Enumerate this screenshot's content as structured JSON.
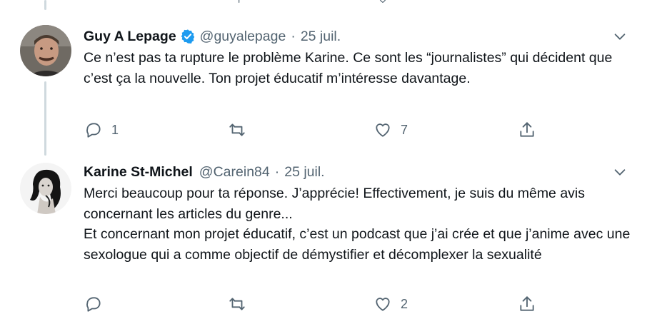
{
  "colors": {
    "accent": "#1d9bf0",
    "muted": "#536471",
    "text": "#0f1419",
    "thread_line": "#cfd9de"
  },
  "tweets": [
    {
      "name": "Guy A Lepage",
      "verified": true,
      "handle": "@guyalepage",
      "separator": "·",
      "date": "25 juil.",
      "text": [
        "Ce n’est pas ta rupture le problème Karine. Ce sont les “journalistes” qui décident que c’est ça la nouvelle. Ton projet éducatif m’intéresse davantage."
      ],
      "replies": "1",
      "retweets": "",
      "likes": "7",
      "avatar": "avatar-photo"
    },
    {
      "name": "Karine St-Michel",
      "verified": false,
      "handle": "@Carein84",
      "separator": "·",
      "date": "25 juil.",
      "text": [
        "Merci beaucoup pour ta réponse. J’apprécie! Effectivement, je suis du même avis concernant les articles du genre...",
        "Et concernant mon projet éducatif, c’est un podcast que j’ai crée et que j’anime avec une sexologue qui a comme objectif de démystifier et décomplexer la sexualité"
      ],
      "replies": "",
      "retweets": "",
      "likes": "2",
      "avatar": "avatar-photo"
    }
  ],
  "icons": {
    "reply": "reply-icon",
    "retweet": "retweet-icon",
    "like": "heart-icon",
    "share": "share-icon",
    "more": "chevron-down-icon",
    "verified": "verified-badge-icon"
  }
}
